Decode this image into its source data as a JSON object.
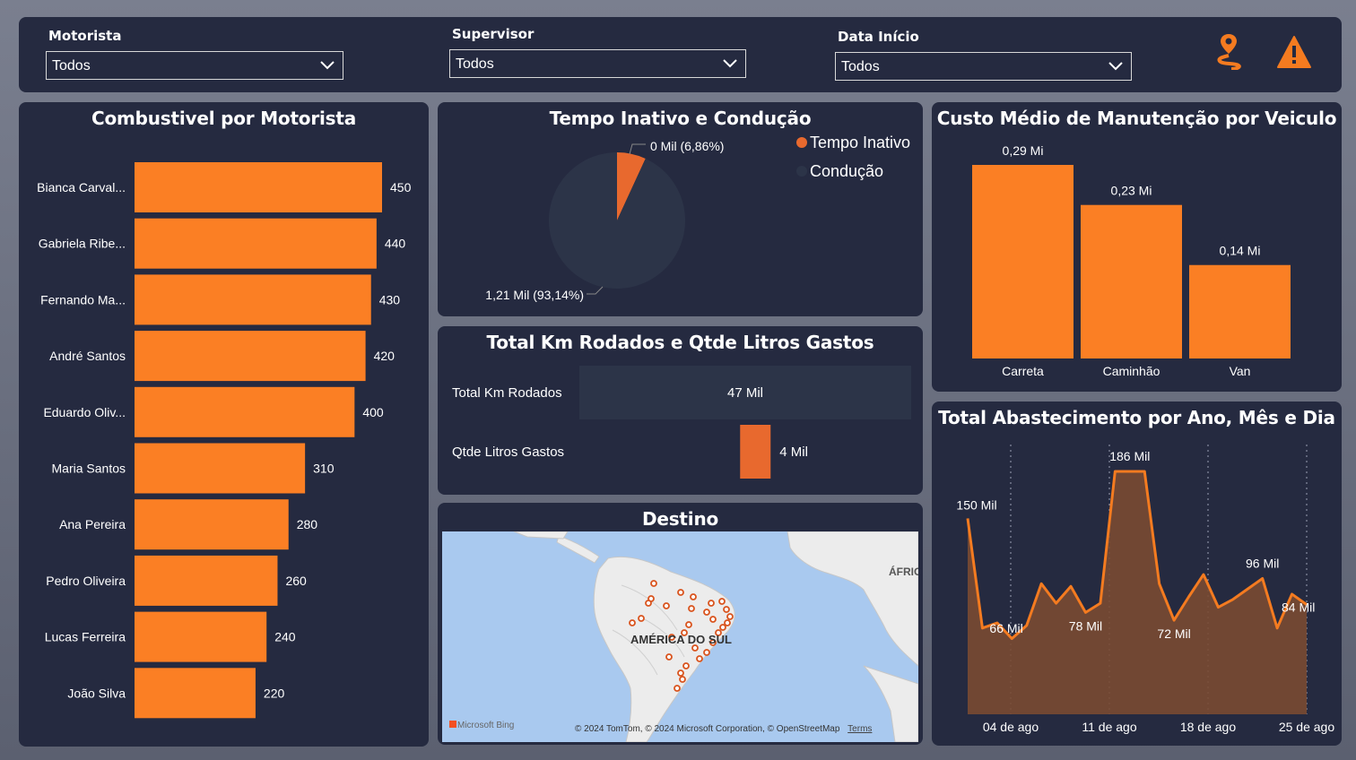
{
  "filters": {
    "motorista": {
      "label": "Motorista",
      "value": "Todos"
    },
    "supervisor": {
      "label": "Supervisor",
      "value": "Todos"
    },
    "data_inicio": {
      "label": "Data Início",
      "value": "Todos"
    }
  },
  "icons": {
    "route": "route-pin-icon",
    "alert": "warning-icon",
    "accent": "#f47b20"
  },
  "combustivel": {
    "title": "Combustivel por Motorista",
    "chart_data": {
      "type": "bar",
      "orientation": "horizontal",
      "categories": [
        "Bianca Carval...",
        "Gabriela Ribe...",
        "Fernando Ma...",
        "André Santos",
        "Eduardo Oliv...",
        "Maria Santos",
        "Ana Pereira",
        "Pedro Oliveira",
        "Lucas Ferreira",
        "João Silva"
      ],
      "values": [
        450,
        440,
        430,
        420,
        400,
        310,
        280,
        260,
        240,
        220
      ],
      "color": "#fb7f24"
    }
  },
  "tempo": {
    "title": "Tempo Inativo e Condução",
    "chart_data": {
      "type": "pie",
      "series": [
        {
          "name": "Tempo Inativo",
          "label": "0 Mil (6,86%)",
          "percent": 6.86,
          "color": "#e8692e"
        },
        {
          "name": "Condução",
          "label": "1,21 Mil (93,14%)",
          "percent": 93.14,
          "color": "#2c3448"
        }
      ],
      "legend": "top-right"
    }
  },
  "km": {
    "title": "Total Km Rodados e Qtde Litros Gastos",
    "chart_data": {
      "type": "bar",
      "orientation": "horizontal",
      "categories": [
        "Total Km Rodados",
        "Qtde Litros Gastos"
      ],
      "values": [
        47,
        4
      ],
      "labels": [
        "47 Mil",
        "4 Mil"
      ],
      "colors": [
        "#2c3448",
        "#e8692e"
      ]
    }
  },
  "destino": {
    "title": "Destino",
    "continent_label": "AMÉRICA DO SUL",
    "africa_label": "ÁFRIC",
    "bing": "Microsoft Bing",
    "credit": "© 2024 TomTom, © 2024 Microsoft Corporation, © OpenStreetMap",
    "terms": "Terms"
  },
  "custo": {
    "title": "Custo Médio de Manutenção por Veiculo",
    "chart_data": {
      "type": "bar",
      "categories": [
        "Carreta",
        "Caminhão",
        "Van"
      ],
      "values": [
        0.29,
        0.23,
        0.14
      ],
      "labels": [
        "0,29 Mi",
        "0,23 Mi",
        "0,14 Mi"
      ],
      "color": "#fb7f24"
    }
  },
  "abastecimento": {
    "title": "Total Abastecimento por Ano, Mês e Dia",
    "chart_data": {
      "type": "area",
      "x_ticks": [
        "04 de ago",
        "11 de ago",
        "18 de ago",
        "25 de ago"
      ],
      "values": [
        150,
        66,
        70,
        58,
        68,
        100,
        85,
        98,
        78,
        85,
        186,
        186,
        186,
        100,
        72,
        90,
        107,
        82,
        88,
        96,
        104,
        66,
        92,
        84
      ],
      "point_labels": [
        {
          "index": 0,
          "text": "150 Mil"
        },
        {
          "index": 1,
          "text": "66 Mil"
        },
        {
          "index": 8,
          "text": "78 Mil"
        },
        {
          "index": 11,
          "text": "186 Mil"
        },
        {
          "index": 14,
          "text": "72 Mil"
        },
        {
          "index": 20,
          "text": "96 Mil"
        },
        {
          "index": 23,
          "text": "84 Mil"
        }
      ],
      "line_color": "#f47b20",
      "fill_color": "#7a4a32"
    }
  }
}
